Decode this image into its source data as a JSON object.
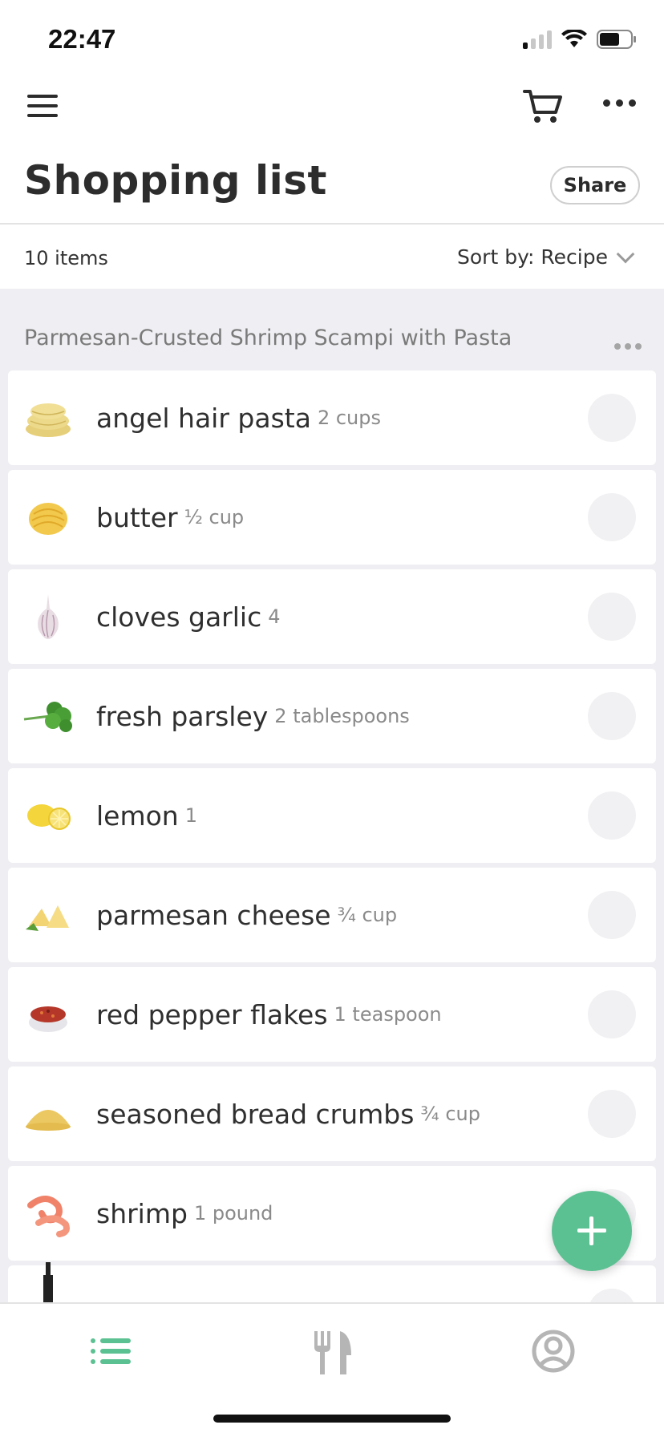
{
  "status_bar": {
    "time": "22:47",
    "icons": [
      "signal-icon",
      "wifi-icon",
      "battery-icon"
    ]
  },
  "nav": {
    "menu_icon": "hamburger-menu-icon",
    "cart_icon": "shopping-cart-icon",
    "more_icon": "more-horizontal-icon"
  },
  "header": {
    "title": "Shopping list",
    "share_label": "Share"
  },
  "toolbar": {
    "item_count": "10 items",
    "sort_label": "Sort by: Recipe"
  },
  "section": {
    "title": "Parmesan-Crusted Shrimp Scampi with Pasta",
    "items": [
      {
        "name": "angel hair pasta",
        "qty": "2  cups",
        "icon": "pasta-icon"
      },
      {
        "name": "butter",
        "qty": "½ cup",
        "icon": "butter-icon"
      },
      {
        "name": "cloves garlic",
        "qty": "4",
        "icon": "garlic-icon"
      },
      {
        "name": "fresh parsley",
        "qty": "2  tablespoons",
        "icon": "parsley-icon"
      },
      {
        "name": "lemon",
        "qty": "1",
        "icon": "lemon-icon"
      },
      {
        "name": "parmesan cheese",
        "qty": "¾ cup",
        "icon": "cheese-icon"
      },
      {
        "name": "red pepper flakes",
        "qty": "1  teaspoon",
        "icon": "pepper-flakes-icon"
      },
      {
        "name": "seasoned bread crumbs",
        "qty": "¾ cup",
        "icon": "bread-crumbs-icon"
      },
      {
        "name": "shrimp",
        "qty": "1 pound",
        "icon": "shrimp-icon"
      },
      {
        "name": "",
        "qty": "",
        "icon": "wine-bottle-icon"
      }
    ]
  },
  "fab": {
    "icon": "plus-icon"
  },
  "bottom_nav": {
    "tabs": [
      {
        "name": "list",
        "icon": "list-icon",
        "active": true
      },
      {
        "name": "recipes",
        "icon": "fork-knife-icon",
        "active": false
      },
      {
        "name": "profile",
        "icon": "user-circle-icon",
        "active": false
      }
    ]
  },
  "colors": {
    "accent": "#5cc192",
    "list_background": "#efeff3",
    "inactive_icon": "#b5b5b5"
  }
}
